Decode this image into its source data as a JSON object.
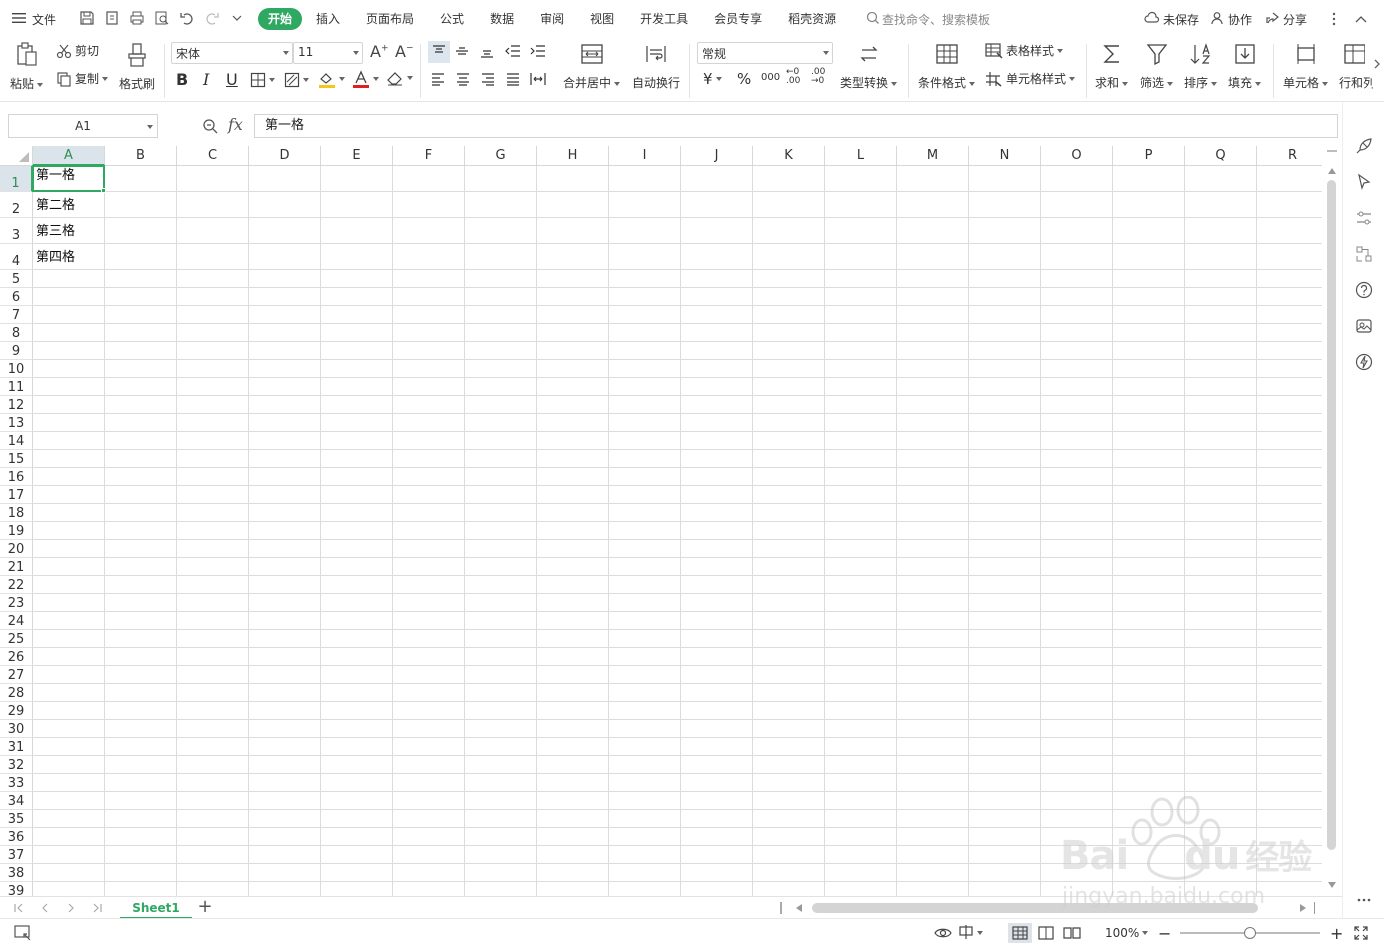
{
  "menubar": {
    "file_label": "文件",
    "tabs": [
      {
        "label": "开始",
        "active": true
      },
      {
        "label": "插入"
      },
      {
        "label": "页面布局"
      },
      {
        "label": "公式"
      },
      {
        "label": "数据"
      },
      {
        "label": "审阅"
      },
      {
        "label": "视图"
      },
      {
        "label": "开发工具"
      },
      {
        "label": "会员专享"
      },
      {
        "label": "稻壳资源"
      }
    ],
    "search_placeholder": "查找命令、搜索模板",
    "unsaved_label": "未保存",
    "collab_label": "协作",
    "share_label": "分享"
  },
  "ribbon": {
    "paste": "粘贴",
    "cut": "剪切",
    "copy": "复制",
    "format_painter": "格式刷",
    "font_name": "宋体",
    "font_size": "11",
    "merge_center": "合并居中",
    "wrap_text": "自动换行",
    "number_format": "常规",
    "currency_symbol": "¥",
    "percent_symbol": "%",
    "thousands_symbol": "000",
    "inc_decimal": "←0 .00",
    "dec_decimal": ".00 →0",
    "type_convert": "类型转换",
    "conditional_format": "条件格式",
    "table_style": "表格样式",
    "cell_style": "单元格样式",
    "sum": "求和",
    "filter": "筛选",
    "sort": "排序",
    "fill": "填充",
    "cells": "单元格",
    "rows_cols": "行和列",
    "bold": "B",
    "italic": "I",
    "underline": "U"
  },
  "formula_bar": {
    "name_box": "A1",
    "fx_label": "fx",
    "value": "第一格"
  },
  "sheet": {
    "columns": [
      "A",
      "B",
      "C",
      "D",
      "E",
      "F",
      "G",
      "H",
      "I",
      "J",
      "K",
      "L",
      "M",
      "N",
      "O",
      "P",
      "Q",
      "R"
    ],
    "rows": [
      "1",
      "2",
      "3",
      "4",
      "5",
      "6",
      "7",
      "8",
      "9",
      "10",
      "11",
      "12",
      "13",
      "14",
      "15",
      "16",
      "17",
      "18",
      "19",
      "20",
      "21",
      "22",
      "23",
      "24",
      "25",
      "26",
      "27",
      "28",
      "29",
      "30",
      "31",
      "32",
      "33",
      "34",
      "35",
      "36",
      "37",
      "38",
      "39"
    ],
    "cells": [
      {
        "col": "A",
        "row": "1",
        "value": "第一格"
      },
      {
        "col": "A",
        "row": "2",
        "value": "第二格"
      },
      {
        "col": "A",
        "row": "3",
        "value": "第三格"
      },
      {
        "col": "A",
        "row": "4",
        "value": "第四格"
      }
    ],
    "selected_col": "A",
    "selected_row": "1"
  },
  "sheet_tabs": {
    "active": "Sheet1",
    "add_label": "+"
  },
  "statusbar": {
    "zoom": "100%",
    "zoom_fraction": 0.5,
    "minus": "−",
    "plus": "+"
  },
  "watermark": {
    "brand": "Bai",
    "brand2": "du",
    "cn": "经验",
    "url": "jingyan.baidu.com"
  },
  "colors": {
    "accent": "#2fa862",
    "header_selected_bg": "#dbe3eb",
    "grid_line": "#dcdcdc"
  }
}
